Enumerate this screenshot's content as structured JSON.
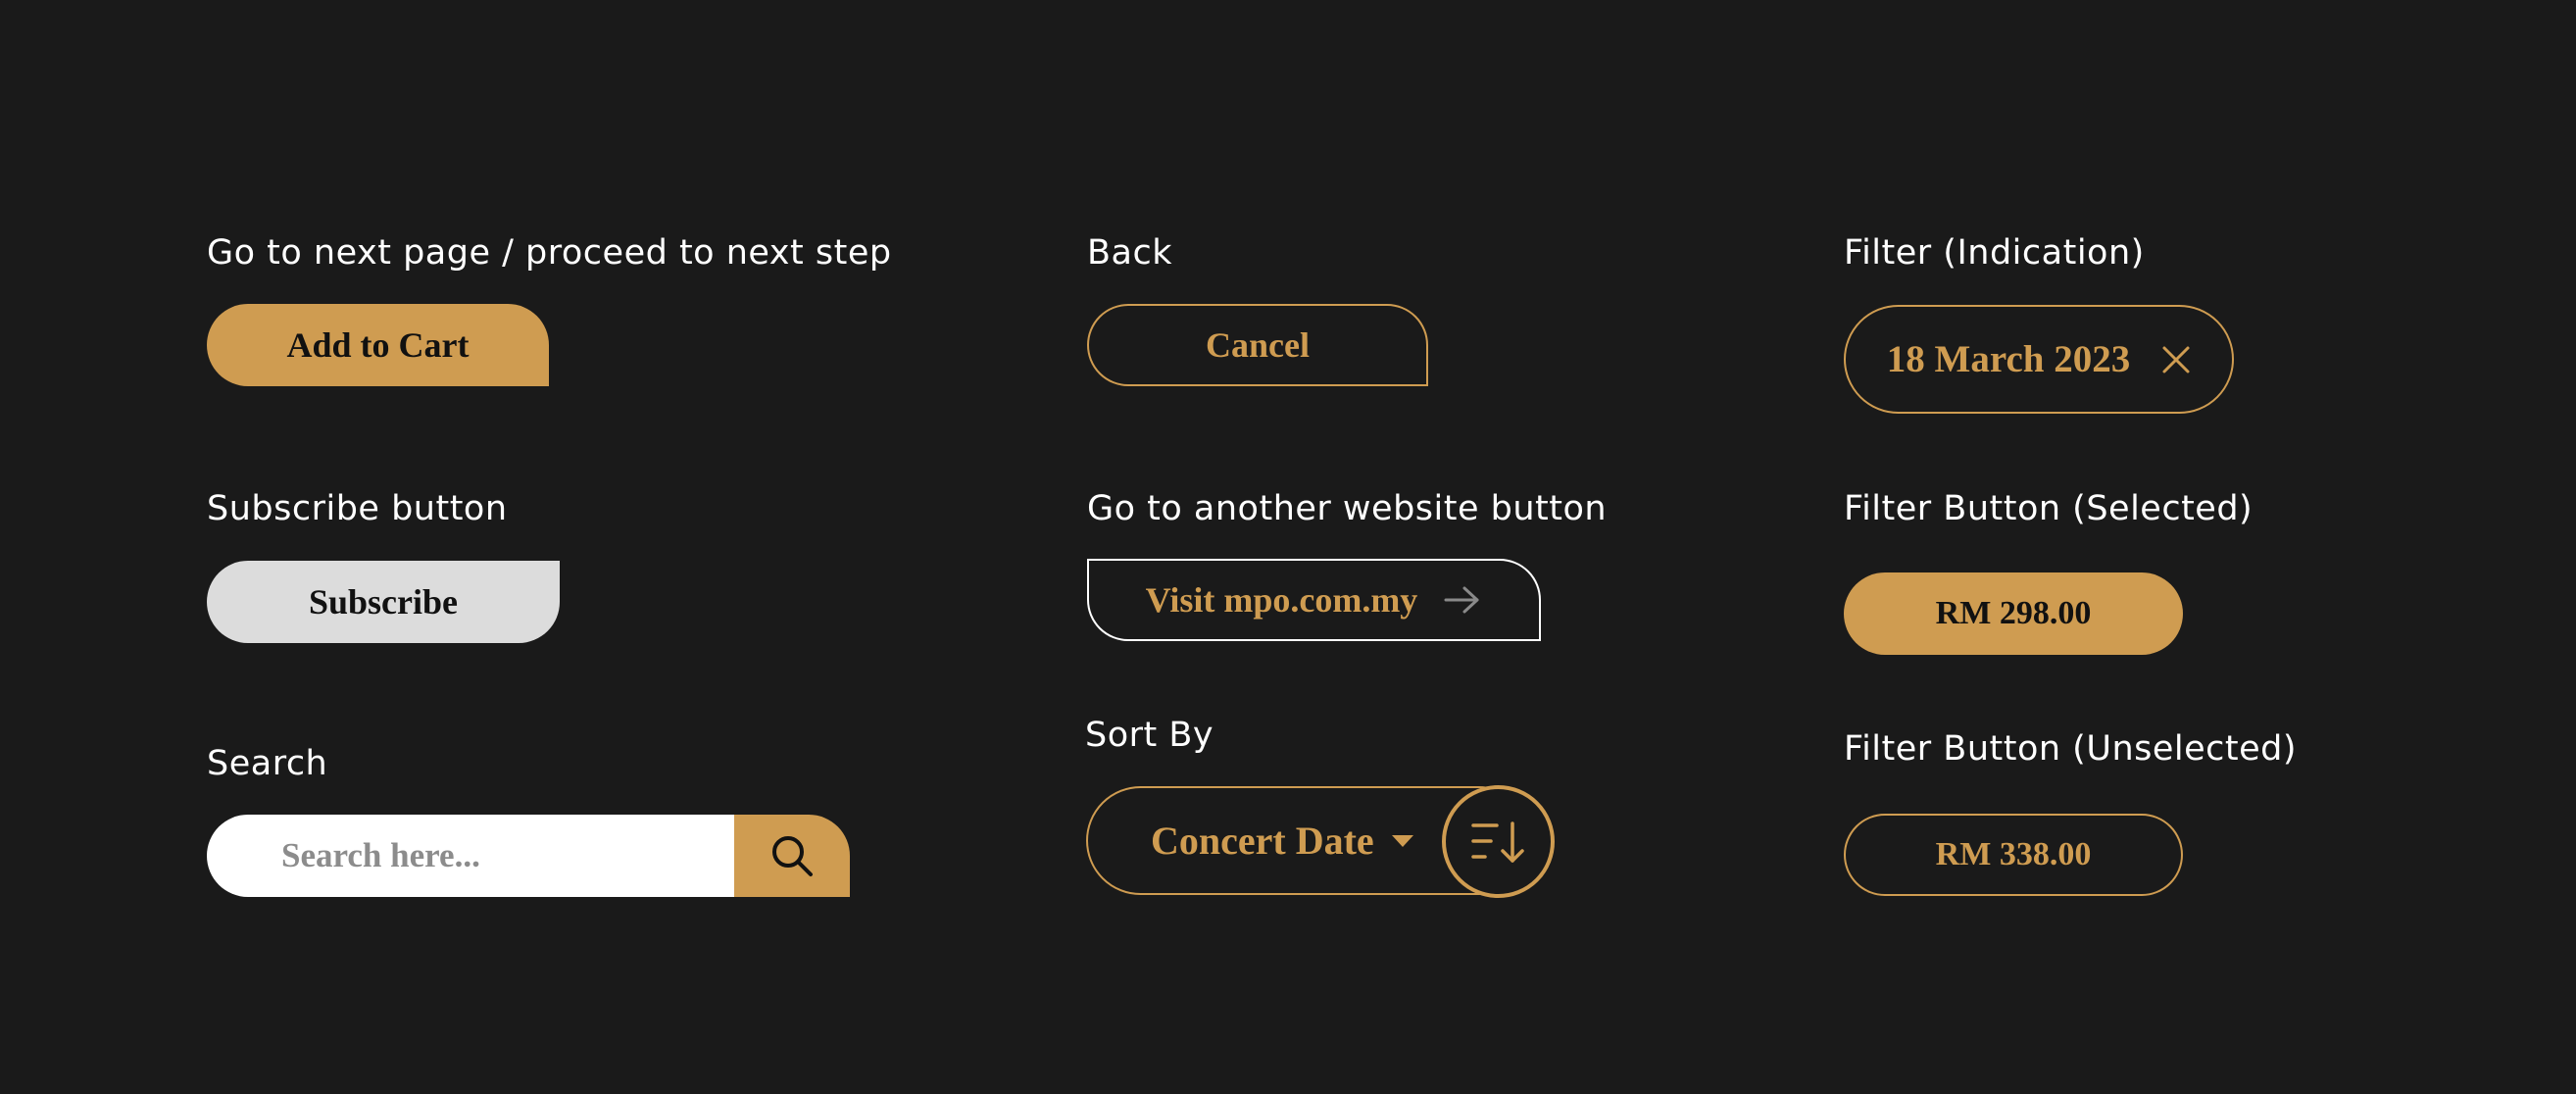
{
  "labels": {
    "next_step": "Go to next page / proceed to next step",
    "back": "Back",
    "filter_indication": "Filter (Indication)",
    "subscribe": "Subscribe button",
    "external": "Go to another website button",
    "filter_selected": "Filter Button (Selected)",
    "search": "Search",
    "sort_by": "Sort By",
    "filter_unselected": "Filter Button (Unselected)"
  },
  "buttons": {
    "add_to_cart": "Add to Cart",
    "cancel": "Cancel",
    "subscribe": "Subscribe",
    "visit": "Visit mpo.com.my",
    "filter_chip": "18 March 2023",
    "filter_selected": "RM 298.00",
    "filter_unselected": "RM 338.00"
  },
  "search": {
    "placeholder": "Search here...",
    "value": ""
  },
  "sort": {
    "selected": "Concert Date"
  },
  "icons": {
    "close": "close-icon",
    "arrow": "arrow-right-icon",
    "search": "search-icon",
    "caret": "caret-down-icon",
    "sort": "sort-descending-icon"
  },
  "colors": {
    "background": "#1a1a1a",
    "accent": "#cf9c51",
    "light_button": "#dcdcdc",
    "text": "#ffffff"
  }
}
